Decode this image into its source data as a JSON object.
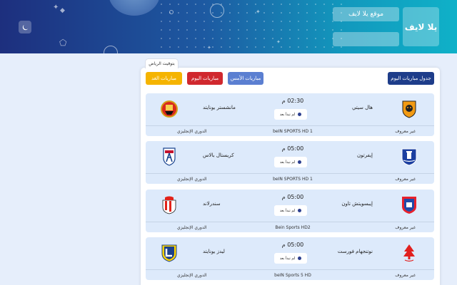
{
  "header": {
    "logo_text": "يلا لايف",
    "site_button": "موقع يلا لايف",
    "search_placeholder": "",
    "theme_icon": "moon-icon"
  },
  "timezone_tab": "بتوقيت الرياض",
  "nav": {
    "matches_table": "جدول مباريات اليوم",
    "yesterday": "مباريات الأمس",
    "today": "مباريات اليوم",
    "tomorrow": "مباريات الغد"
  },
  "colors": {
    "header_start": "#1d2f7e",
    "header_end": "#0fb1c8",
    "today": "#d0282e",
    "tomorrow": "#f5b400",
    "yesterday": "#5b7fd1",
    "table": "#1e3d8a",
    "card": "#ddeafb"
  },
  "matches": [
    {
      "home": "هال سيتي",
      "away": "مانشستر يونايتد",
      "time": "02:30 م",
      "status": "لم تبدأ بعد",
      "commentator": "غير معروف",
      "channel": "beIN SPORTS HD 1",
      "league": "الدوري الإنجليزي",
      "home_crest": "hull-city-crest-icon",
      "away_crest": "manchester-united-crest-icon"
    },
    {
      "home": "إيفرتون",
      "away": "كريستال بالاس",
      "time": "05:00 م",
      "status": "لم تبدأ بعد",
      "commentator": "غير معروف",
      "channel": "beIN SPORTS HD 1",
      "league": "الدوري الإنجليزي",
      "home_crest": "everton-crest-icon",
      "away_crest": "crystal-palace-crest-icon"
    },
    {
      "home": "إيبسويتش تاون",
      "away": "سندرلاند",
      "time": "05:00 م",
      "status": "لم تبدأ بعد",
      "commentator": "غير معروف",
      "channel": "Bein Sports HD2",
      "league": "الدوري الإنجليزي",
      "home_crest": "ipswich-town-crest-icon",
      "away_crest": "sunderland-crest-icon"
    },
    {
      "home": "نوتنجهام فورست",
      "away": "ليدز يونايتد",
      "time": "05:00 م",
      "status": "لم تبدأ بعد",
      "commentator": "غير معروف",
      "channel": "beIN Sports 5 HD",
      "league": "الدوري الإنجليزي",
      "home_crest": "nottingham-forest-crest-icon",
      "away_crest": "leeds-united-crest-icon"
    }
  ]
}
